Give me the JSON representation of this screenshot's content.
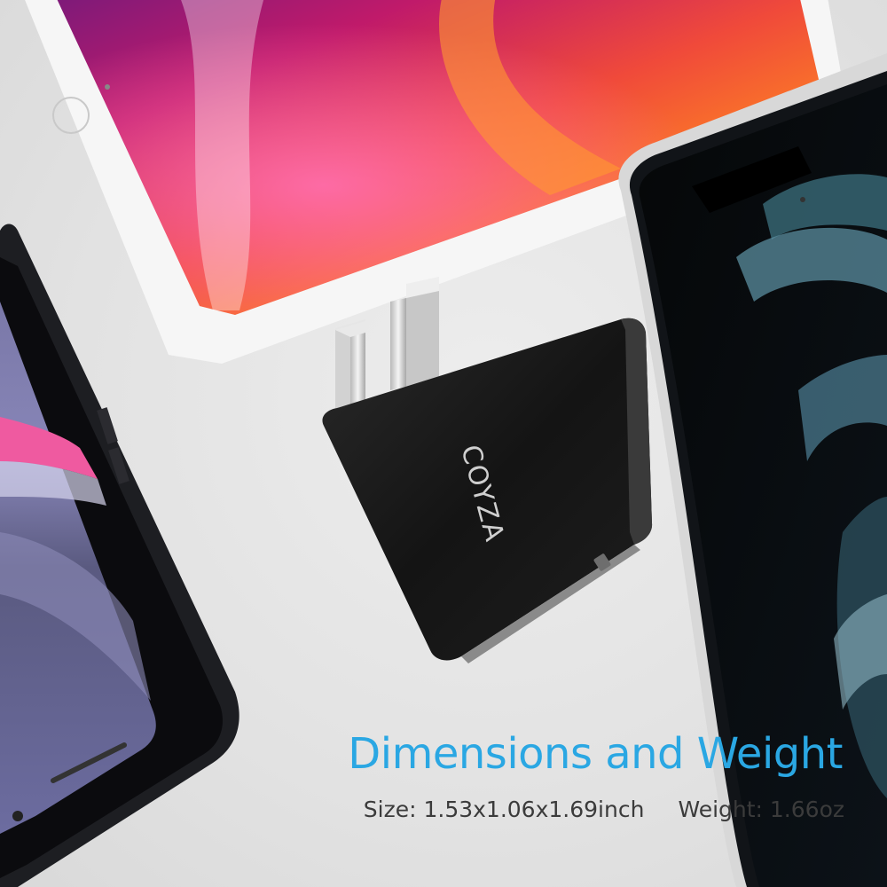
{
  "brand": "COYZA",
  "headline": "Dimensions and Weight",
  "specs": {
    "size": "Size: 1.53x1.06x1.69inch",
    "weight": "Weight: 1.66oz"
  },
  "colors": {
    "headline": "#2aa7e3",
    "specs": "#3b3b3b",
    "background": "#e4e4e4",
    "charter_body": "#1a1a1a"
  }
}
